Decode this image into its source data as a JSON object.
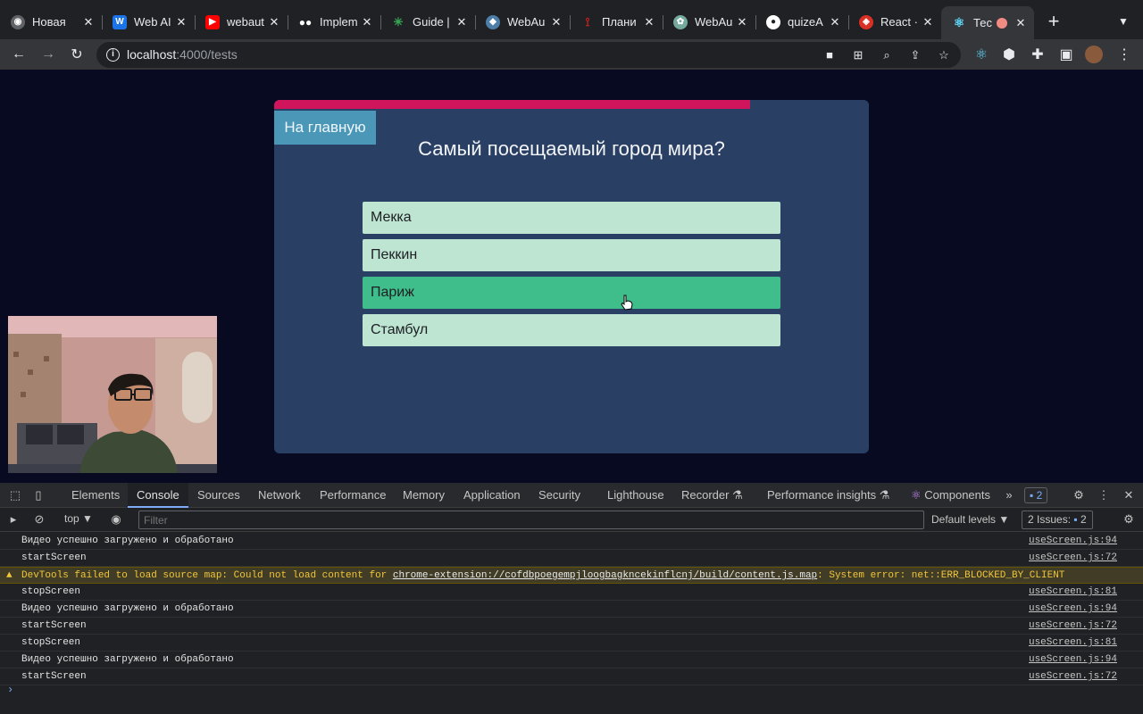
{
  "browser": {
    "tabs": [
      {
        "label": "Новая",
        "icon": "chrome-icon",
        "color": "#5f6368"
      },
      {
        "label": "Web AI",
        "icon": "web-ai-icon",
        "color": "#1a73e8"
      },
      {
        "label": "webaut",
        "icon": "youtube-icon",
        "color": "#ff0000"
      },
      {
        "label": "Implem",
        "icon": "medium-icon",
        "color": "#ffffff"
      },
      {
        "label": "Guide |",
        "icon": "guide-icon",
        "color": "#34a853"
      },
      {
        "label": "WebAu",
        "icon": "webauthn-icon",
        "color": "#4d7ea8"
      },
      {
        "label": "Плани",
        "icon": "planner-icon",
        "color": "#c5221f"
      },
      {
        "label": "WebAu",
        "icon": "chatgpt-icon",
        "color": "#74aa9c"
      },
      {
        "label": "quizeA",
        "icon": "github-icon",
        "color": "#ffffff"
      },
      {
        "label": "React ·",
        "icon": "react-icon",
        "color": "#e8eaed"
      },
      {
        "label": "Тес",
        "icon": "react-icon",
        "color": "#61dafb"
      }
    ],
    "url_host": "localhost",
    "url_path": ":4000/tests"
  },
  "quiz": {
    "progress_fraction": 0.8,
    "home_label": "На главную",
    "question": "Самый посещаемый город мира?",
    "answers": [
      "Мекка",
      "Пеккин",
      "Париж",
      "Стамбул"
    ],
    "hovered_answer": 2
  },
  "devtools": {
    "tabs": [
      "Elements",
      "Console",
      "Sources",
      "Network",
      "Performance",
      "Memory",
      "Application",
      "Security",
      "Lighthouse",
      "Recorder",
      "Performance insights",
      "Components"
    ],
    "active_tab": "Console",
    "issues_badge": "2",
    "context": "top",
    "filter_placeholder": "Filter",
    "levels": "Default levels",
    "issues_label": "2 Issues:",
    "issues_count": "2",
    "console_lines": [
      {
        "text": "Видео успешно загружено и обработано",
        "source": "useScreen.js:94",
        "level": "log"
      },
      {
        "text": "startScreen",
        "source": "useScreen.js:72",
        "level": "log"
      },
      {
        "text_pre": "DevTools failed to load source map: Could not load content for ",
        "link": "chrome-extension://cofdbpoegempjloogbagkncekinflcnj/build/content.js.map",
        "text_post": ": System error: net::ERR_BLOCKED_BY_CLIENT",
        "level": "warning"
      },
      {
        "text": "stopScreen",
        "source": "useScreen.js:81",
        "level": "log"
      },
      {
        "text": "Видео успешно загружено и обработано",
        "source": "useScreen.js:94",
        "level": "log"
      },
      {
        "text": "startScreen",
        "source": "useScreen.js:72",
        "level": "log"
      },
      {
        "text": "stopScreen",
        "source": "useScreen.js:81",
        "level": "log"
      },
      {
        "text": "Видео успешно загружено и обработано",
        "source": "useScreen.js:94",
        "level": "log"
      },
      {
        "text": "startScreen",
        "source": "useScreen.js:72",
        "level": "log"
      }
    ]
  }
}
